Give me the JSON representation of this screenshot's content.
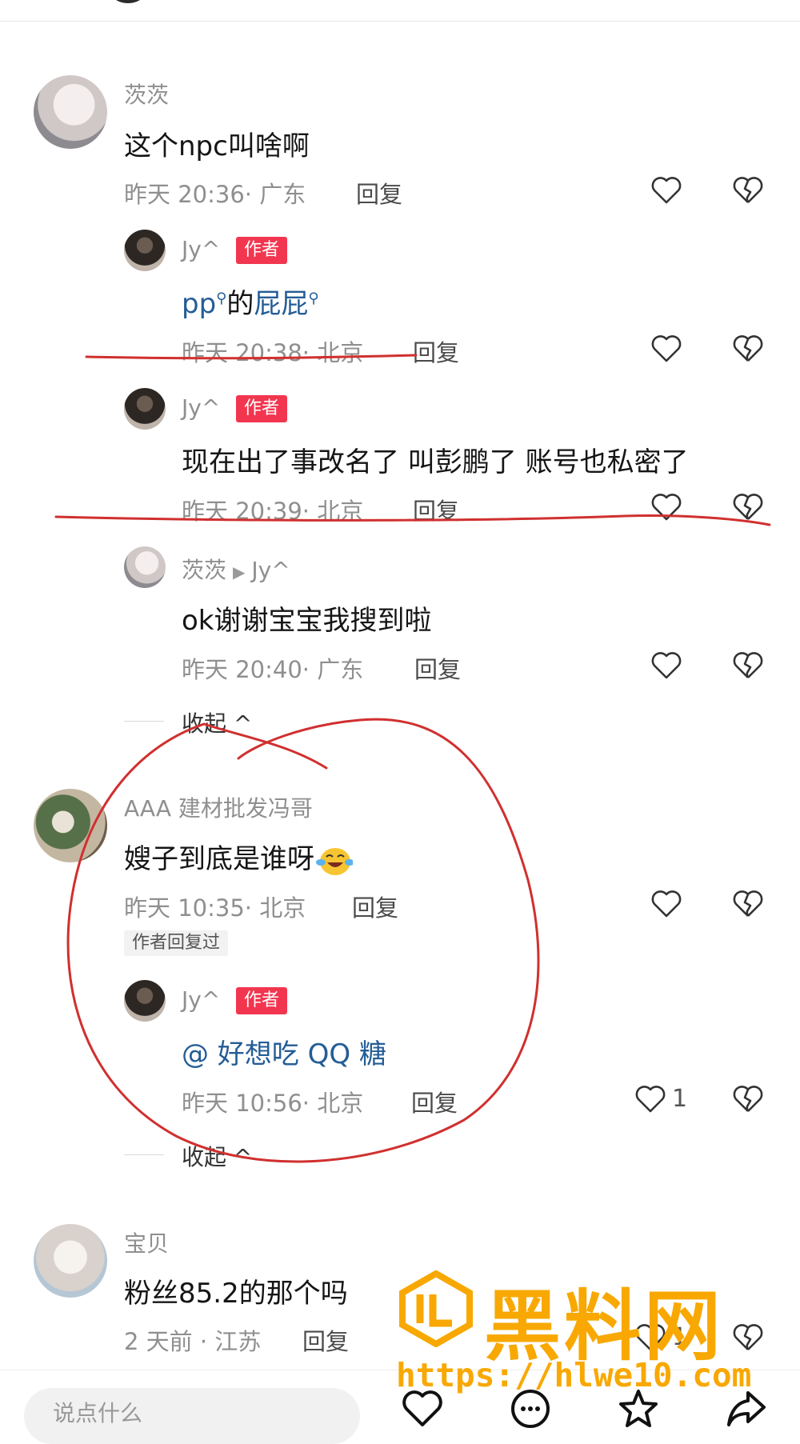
{
  "comments": [
    {
      "user": "茨茨",
      "text": "这个npc叫啥啊",
      "time": "昨天 20:36· 广东",
      "reply": "回复",
      "replies": [
        {
          "user": "Jy^",
          "badge": "作者",
          "text_a": "pp",
          "text_b": "的",
          "text_c": "屁屁",
          "time": "昨天 20:38· 北京",
          "reply": "回复"
        },
        {
          "user": "Jy^",
          "badge": "作者",
          "text": "现在出了事改名了 叫彭鹏了 账号也私密了",
          "time": "昨天 20:39· 北京",
          "reply": "回复"
        },
        {
          "user": "茨茨",
          "reply_to": "Jy^",
          "text": "ok谢谢宝宝我搜到啦",
          "time": "昨天 20:40· 广东",
          "reply": "回复"
        }
      ],
      "collapse": "收起 ^"
    },
    {
      "user": "AAA 建材批发冯哥",
      "text": "嫂子到底是谁呀",
      "time": "昨天 10:35· 北京",
      "reply": "回复",
      "tag": "作者回复过",
      "replies": [
        {
          "user": "Jy^",
          "badge": "作者",
          "text": "@ 好想吃 QQ 糖",
          "time": "昨天 10:56· 北京",
          "reply": "回复",
          "likes": "1"
        }
      ],
      "collapse": "收起 ^"
    },
    {
      "user": "宝贝",
      "text": "粉丝85.2的那个吗",
      "time": "2 天前 · 江苏",
      "reply": "回复",
      "likes": "1"
    }
  ],
  "watermark": {
    "title": "黑料网",
    "url": "https://hlwe10.com"
  },
  "bottom_bar": {
    "input_placeholder": "说点什么"
  },
  "colors": {
    "author_badge": "#f2364f",
    "link": "#245d96",
    "annotation": "#d0302f",
    "watermark": "#f8a800"
  },
  "icons": [
    "heart-icon",
    "broken-heart-icon",
    "search-icon",
    "emoji-icon",
    "comment-icon",
    "star-icon",
    "share-icon"
  ]
}
